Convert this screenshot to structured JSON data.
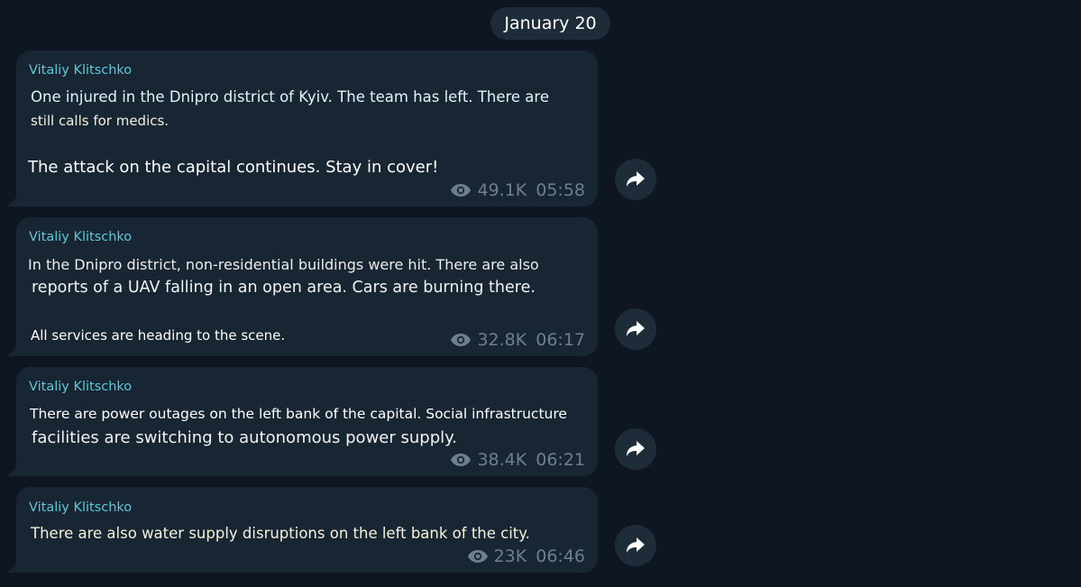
{
  "date_label": "January 20",
  "messages": [
    {
      "sender": "Vitaliy Klitschko",
      "lines": [
        "One injured in the Dnipro district of Kyiv. The team has left. There are",
        "still calls for medics.",
        "The attack on the capital continues. Stay in cover!"
      ],
      "views": "49.1K",
      "time": "05:58"
    },
    {
      "sender": "Vitaliy Klitschko",
      "lines": [
        "In the Dnipro district, non-residential buildings were hit. There are also",
        "reports of a UAV falling in an open area. Cars are burning there.",
        "All services are heading to the scene."
      ],
      "views": "32.8K",
      "time": "06:17"
    },
    {
      "sender": "Vitaliy Klitschko",
      "lines": [
        "There are power outages on the left bank of the capital. Social infrastructure",
        "facilities are switching to autonomous power supply."
      ],
      "views": "38.4K",
      "time": "06:21"
    },
    {
      "sender": "Vitaliy Klitschko",
      "lines": [
        "There are also water supply disruptions on the left bank of the city."
      ],
      "views": "23K",
      "time": "06:46"
    }
  ],
  "icons": {
    "views": "eye-icon",
    "forward": "forward-arrow-icon"
  },
  "colors": {
    "background": "#0e1621",
    "bubble": "#182533",
    "sender": "#5ec8d8",
    "meta": "#6d7f8f",
    "text": "#ffffff"
  }
}
